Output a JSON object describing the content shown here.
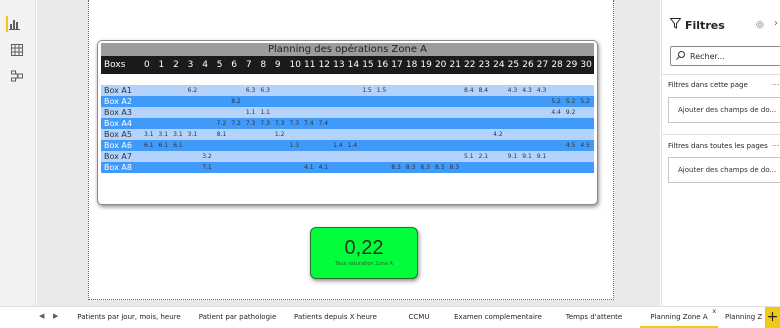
{
  "visual": {
    "title": "Planning des opérations Zone A",
    "header_first": "Boxs",
    "columns": [
      "0",
      "1",
      "2",
      "3",
      "4",
      "5",
      "6",
      "7",
      "8",
      "9",
      "10",
      "11",
      "12",
      "13",
      "14",
      "15",
      "16",
      "17",
      "18",
      "19",
      "20",
      "21",
      "22",
      "23",
      "24",
      "25",
      "26",
      "27",
      "28",
      "29",
      "30"
    ],
    "rows": [
      {
        "label": "Box A1",
        "cells": [
          "",
          "",
          "",
          "6.2",
          "",
          "",
          "",
          "6.3",
          "6.3",
          "",
          "",
          "",
          "",
          "",
          "",
          "1.5",
          "1.5",
          "",
          "",
          "",
          "",
          "",
          "8.4",
          "8.4",
          "",
          "4.3",
          "4.3",
          "4.3",
          "",
          "",
          ""
        ]
      },
      {
        "label": "Box A2",
        "cells": [
          "",
          "",
          "",
          "",
          "",
          "",
          "8.2",
          "",
          "",
          "",
          "",
          "",
          "",
          "",
          "",
          "",
          "",
          "",
          "",
          "",
          "",
          "",
          "",
          "",
          "",
          "",
          "",
          "",
          "5.2",
          "5.2",
          "5.2"
        ]
      },
      {
        "label": "Box A3",
        "cells": [
          "",
          "",
          "",
          "",
          "",
          "",
          "",
          "1.1",
          "1.1",
          "",
          "",
          "",
          "",
          "",
          "",
          "",
          "",
          "",
          "",
          "",
          "",
          "",
          "",
          "",
          "",
          "",
          "",
          "",
          "4.4",
          "9.2",
          ""
        ]
      },
      {
        "label": "Box A4",
        "cells": [
          "",
          "",
          "",
          "",
          "",
          "7.2",
          "7.2",
          "7.3",
          "7.3",
          "7.3",
          "7.3",
          "7.4",
          "7.4",
          "",
          "",
          "",
          "",
          "",
          "",
          "",
          "",
          "",
          "",
          "",
          "",
          "",
          "",
          "",
          "",
          "",
          ""
        ]
      },
      {
        "label": "Box A5",
        "cells": [
          "3.1",
          "3.1",
          "3.1",
          "3.1",
          "",
          "8.1",
          "",
          "",
          "",
          "1.2",
          "",
          "",
          "",
          "",
          "",
          "",
          "",
          "",
          "",
          "",
          "",
          "",
          "",
          "",
          "4.2",
          "",
          "",
          "",
          "",
          "",
          ""
        ]
      },
      {
        "label": "Box A6",
        "cells": [
          "6.1",
          "6.1",
          "6.1",
          "",
          "",
          "",
          "",
          "",
          "",
          "",
          "1.3",
          "",
          "",
          "1.4",
          "1.4",
          "",
          "",
          "",
          "",
          "",
          "",
          "",
          "",
          "",
          "",
          "",
          "",
          "",
          "",
          "4.5",
          "4.5"
        ]
      },
      {
        "label": "Box A7",
        "cells": [
          "",
          "",
          "",
          "",
          "3.2",
          "",
          "",
          "",
          "",
          "",
          "",
          "",
          "",
          "",
          "",
          "",
          "",
          "",
          "",
          "",
          "",
          "",
          "5.1",
          "2.1",
          "",
          "9.1",
          "9.1",
          "9.1",
          "",
          "",
          ""
        ]
      },
      {
        "label": "Box A8",
        "cells": [
          "",
          "",
          "",
          "",
          "7.1",
          "",
          "",
          "",
          "",
          "",
          "",
          "4.1",
          "4.1",
          "",
          "",
          "",
          "",
          "8.3",
          "8.3",
          "8.3",
          "8.3",
          "8.3",
          "",
          "",
          "",
          "",
          "",
          "",
          "",
          "",
          ""
        ]
      }
    ]
  },
  "kpi": {
    "value": "0,22",
    "label": "Taux saturation Zone A",
    "color": "#00ff3a"
  },
  "filters": {
    "title": "Filtres",
    "search_placeholder": "Recher...",
    "page_section": "Filtres dans cette page",
    "page_drop": "Ajouter des champs de do...",
    "all_section": "Filtres dans toutes les pages",
    "all_drop": "Ajouter des champs de do...",
    "more": "..."
  },
  "tabs": [
    {
      "label": "Patients par jour, mois, heure"
    },
    {
      "label": "Patient par pathologie"
    },
    {
      "label": "Patients depuis X heure"
    },
    {
      "label": "CCMU"
    },
    {
      "label": "Examen complementaire"
    },
    {
      "label": "Temps d'attente"
    },
    {
      "label": "Planning Zone A",
      "active": true,
      "close": "x"
    },
    {
      "label": "Planning Z"
    }
  ],
  "add_tab": "+",
  "colors": {
    "header": "#1b1b1b",
    "row_light": "#b3d3fd",
    "row_dark": "#3f9af9",
    "accent": "#f2c811",
    "title_bar": "#9c9c9c"
  }
}
